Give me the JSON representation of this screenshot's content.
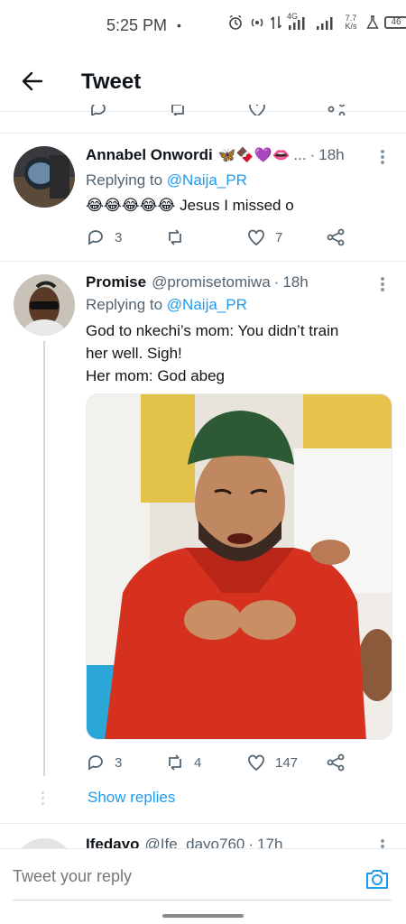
{
  "status_bar": {
    "time": "5:25 PM",
    "dot": "•",
    "network_speed_top": "7.7",
    "network_speed_bottom": "K/s",
    "network_type": "4G",
    "battery_level": "46"
  },
  "header": {
    "title": "Tweet",
    "back_icon": "arrow-left-icon"
  },
  "tweets": [
    {
      "display_name": "Annabel Onwordi",
      "name_emojis": "🦋🍫💜👄",
      "name_truncation": "...",
      "time": "18h",
      "replying_label": "Replying to",
      "replying_to": "@Naija_PR",
      "text_emojis": "😂😂😂😂😂",
      "text": "Jesus I missed o",
      "reply_count": "3",
      "retweet_count": "",
      "like_count": "7"
    },
    {
      "display_name": "Promise",
      "handle": "@promisetomiwa",
      "time": "18h",
      "replying_label": "Replying to",
      "replying_to": "@Naija_PR",
      "text_line1": "God to nkechi’s mom: You didn’t train",
      "text_line2": "her well. Sigh!",
      "text_line3": "Her mom: God abeg",
      "reply_count": "3",
      "retweet_count": "4",
      "like_count": "147",
      "show_replies": "Show replies"
    },
    {
      "display_name": "Ifedayo",
      "handle": "@Ife_dayo760",
      "time": "17h"
    }
  ],
  "reply_bar": {
    "placeholder": "Tweet your reply",
    "camera_icon": "camera-icon"
  },
  "colors": {
    "accent": "#1d9bf0",
    "secondary_text": "#536471",
    "divider": "#e6ecf0"
  }
}
